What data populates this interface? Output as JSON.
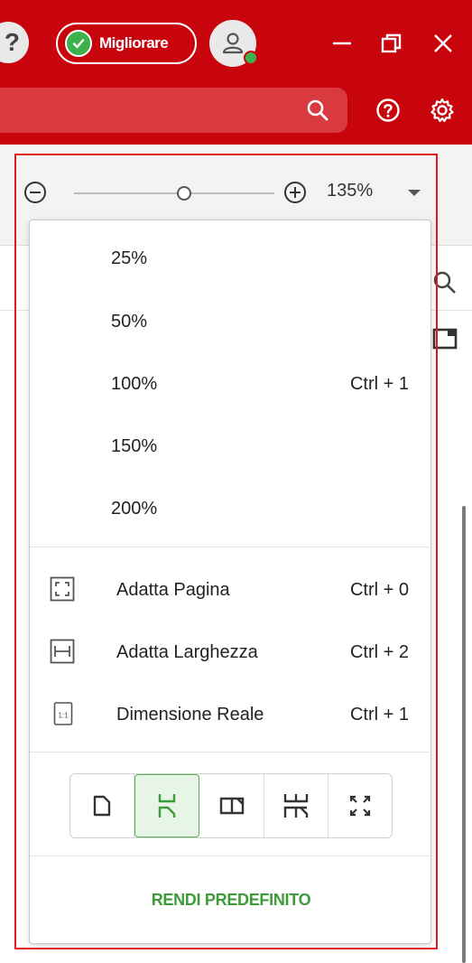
{
  "titlebar": {
    "help_glyph": "?",
    "upgrade_label": "Migliorare",
    "icons": [
      "help-icon",
      "check-circle-icon",
      "user-icon",
      "minimize-icon",
      "restore-icon",
      "close-icon"
    ]
  },
  "toolbar": {
    "icons": [
      "search-icon",
      "help-circle-icon",
      "gear-icon"
    ]
  },
  "zoom": {
    "value_label": "135%",
    "slider_level": 0.5
  },
  "zoom_menu": {
    "presets": [
      {
        "label": "25%",
        "shortcut": ""
      },
      {
        "label": "50%",
        "shortcut": ""
      },
      {
        "label": "100%",
        "shortcut": "Ctrl + 1"
      },
      {
        "label": "150%",
        "shortcut": ""
      },
      {
        "label": "200%",
        "shortcut": ""
      }
    ],
    "fit_options": [
      {
        "label": "Adatta Pagina",
        "shortcut": "Ctrl + 0",
        "icon": "fit-page-icon"
      },
      {
        "label": "Adatta Larghezza",
        "shortcut": "Ctrl + 2",
        "icon": "fit-width-icon"
      },
      {
        "label": "Dimensione Reale",
        "shortcut": "Ctrl + 1",
        "icon": "actual-size-icon",
        "icon_text": "1:1"
      }
    ],
    "view_modes": [
      "single-page-icon",
      "continuous-scroll-icon",
      "two-page-icon",
      "two-page-continuous-icon",
      "fullscreen-icon"
    ],
    "active_view_mode": 1,
    "make_default_label": "RENDI PREDEFINITO"
  },
  "colors": {
    "brand_red": "#c8050d",
    "accent_green": "#3e9b3a",
    "highlight_border": "#e0191f"
  }
}
